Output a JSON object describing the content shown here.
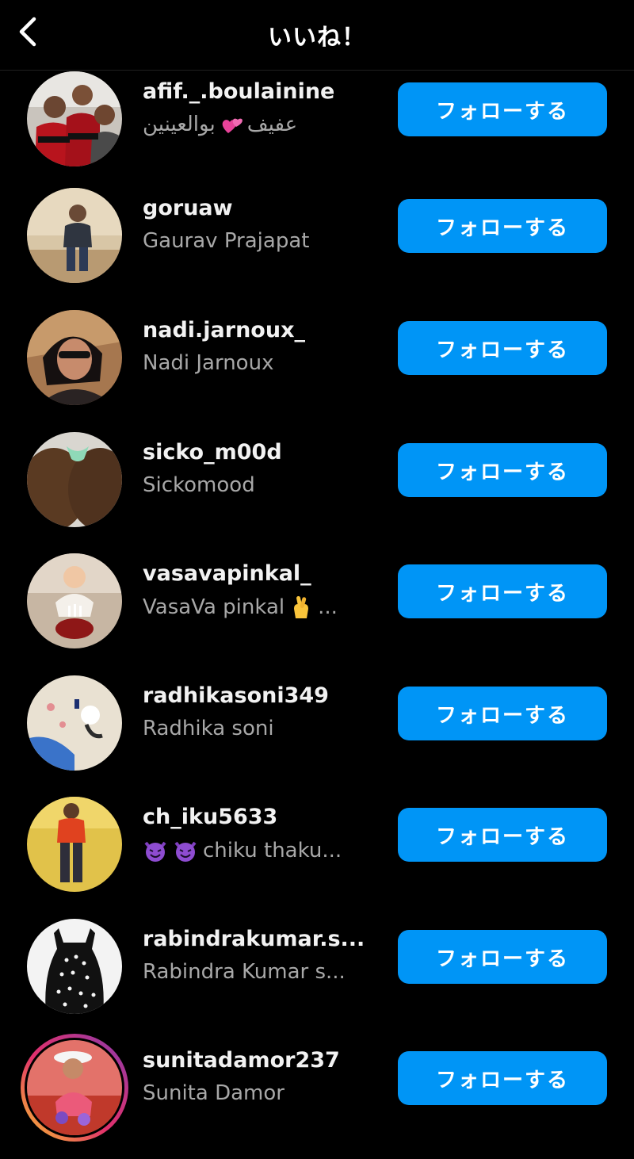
{
  "header": {
    "title": "いいね！"
  },
  "follow_label": "フォローする",
  "users": [
    {
      "username": "afif._.boulainine",
      "fullname_pre": "عفيف",
      "fullname_post": "بوالعينين",
      "emoji": "hearts"
    },
    {
      "username": "goruaw",
      "fullname": "Gaurav Prajapat"
    },
    {
      "username": "nadi.jarnoux_",
      "fullname": "Nadi Jarnoux"
    },
    {
      "username": "sicko_m00d",
      "fullname": "Sickomood"
    },
    {
      "username": "vasavapinkal_",
      "fullname": "VasaVa pinkal",
      "fullname_suffix": "...",
      "emoji": "crossed-fingers"
    },
    {
      "username": "radhikasoni349",
      "fullname": "Radhika soni"
    },
    {
      "username": "ch_iku5633",
      "fullname": "chiku thaku...",
      "emoji": "smiling-devil"
    },
    {
      "username": "rabindrakumar.s...",
      "fullname": "Rabindra Kumar s..."
    },
    {
      "username": "sunitadamor237",
      "fullname": "Sunita Damor",
      "story": true
    }
  ],
  "colors": {
    "background": "#000000",
    "button": "#0095f6",
    "username": "#f2f2f2",
    "fullname": "#a8a8a8"
  }
}
